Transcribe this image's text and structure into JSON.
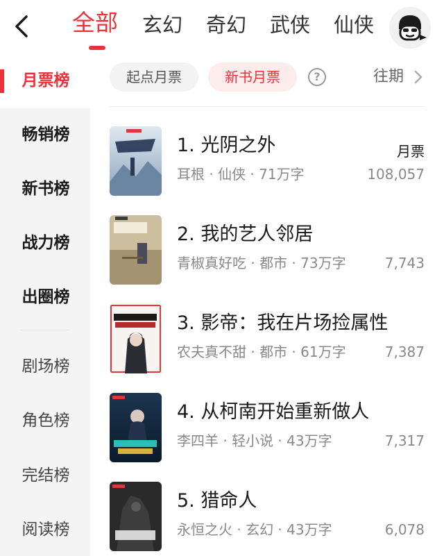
{
  "header": {
    "tabs": [
      {
        "label": "全部",
        "active": true
      },
      {
        "label": "玄幻",
        "active": false
      },
      {
        "label": "奇幻",
        "active": false
      },
      {
        "label": "武侠",
        "active": false
      },
      {
        "label": "仙侠",
        "active": false
      }
    ],
    "back_icon": "chevron-left-icon",
    "avatar_icon": "user-avatar-icon"
  },
  "sidebar": {
    "items": [
      {
        "label": "月票榜",
        "active": true
      },
      {
        "label": "畅销榜"
      },
      {
        "label": "新书榜"
      },
      {
        "label": "战力榜"
      },
      {
        "label": "出圈榜"
      },
      {
        "label": "剧场榜"
      },
      {
        "label": "角色榜"
      },
      {
        "label": "完结榜"
      },
      {
        "label": "阅读榜"
      }
    ]
  },
  "filters": {
    "chips": [
      {
        "label": "起点月票",
        "active": false
      },
      {
        "label": "新书月票",
        "active": true
      }
    ],
    "help_icon": "question-circle-icon",
    "help_symbol": "?",
    "past_label": "往期",
    "past_icon": "chevron-right-icon"
  },
  "list": {
    "votes_label": "月票",
    "books": [
      {
        "rank_title": "1. 光阴之外",
        "meta": "耳根 · 仙侠 · 71万字",
        "votes": "108,057"
      },
      {
        "rank_title": "2. 我的艺人邻居",
        "meta": "青椒真好吃 · 都市 · 73万字",
        "votes": "7,743"
      },
      {
        "rank_title": "3. 影帝：我在片场捡属性",
        "meta": "农夫真不甜 · 都市 · 61万字",
        "votes": "7,387"
      },
      {
        "rank_title": "4. 从柯南开始重新做人",
        "meta": "李四羊 · 轻小说 · 43万字",
        "votes": "7,317"
      },
      {
        "rank_title": "5. 猎命人",
        "meta": "永恒之火 · 玄幻 · 43万字",
        "votes": "6,078"
      }
    ]
  },
  "colors": {
    "accent": "#e8333a",
    "accent_bg": "#fdecec",
    "sidebar_bg": "#f4f4f4",
    "meta_text": "#888888"
  }
}
